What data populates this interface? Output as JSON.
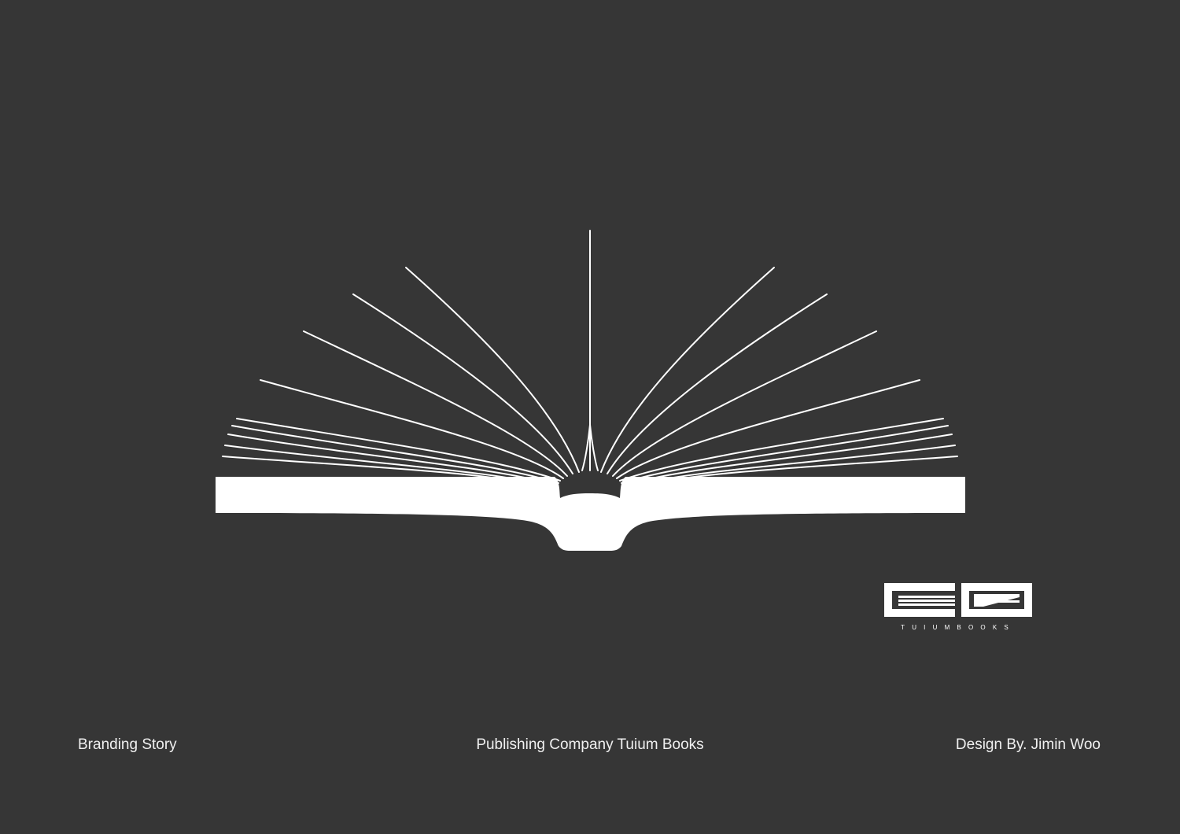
{
  "footer": {
    "left": "Branding Story",
    "center": "Publishing Company Tuium Books",
    "right": "Design By. Jimin Woo"
  },
  "logo": {
    "wordmark": "TUIUMBOOKS"
  },
  "colors": {
    "background": "#363636",
    "foreground": "#ffffff"
  }
}
